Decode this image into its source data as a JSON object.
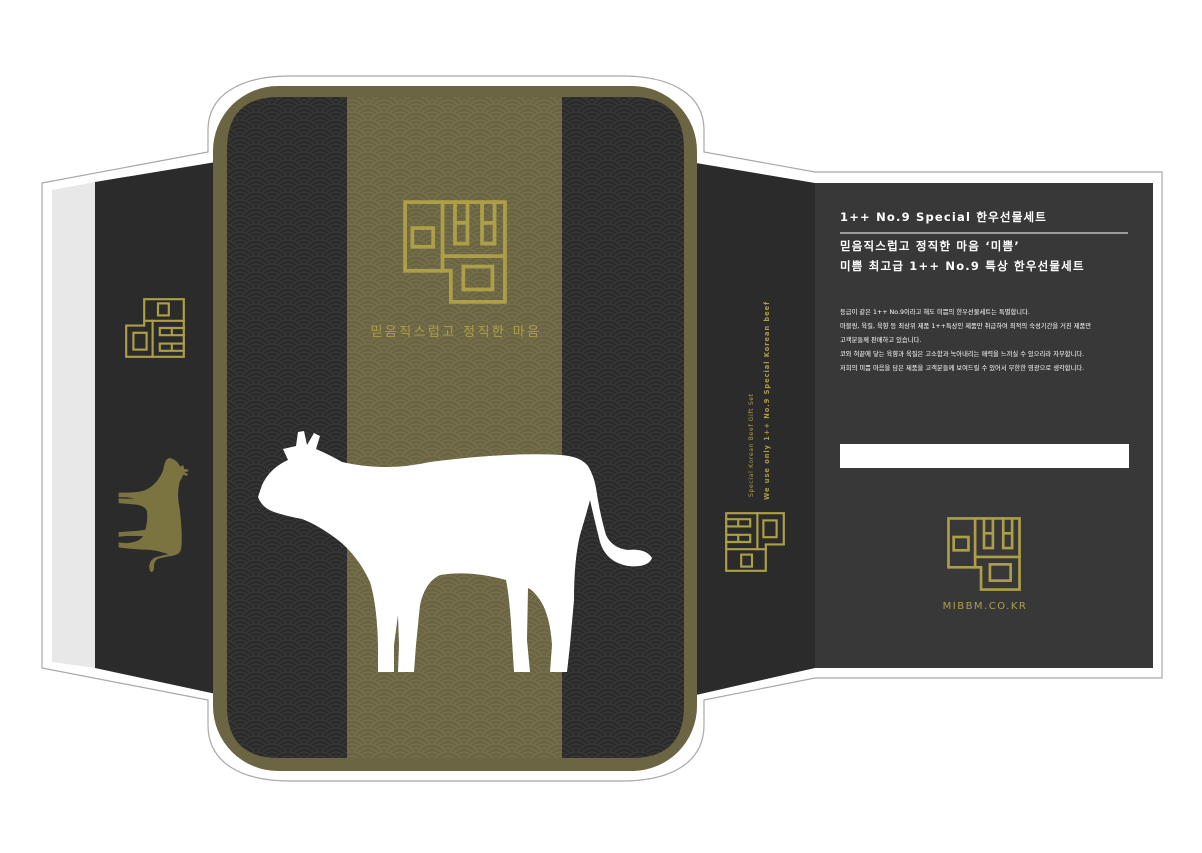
{
  "brand": {
    "name": "미쁨",
    "logo_icon": "mibbm-logo-icon"
  },
  "front_panel": {
    "slogan": "믿음직스럽고 정직한 마음",
    "illustration": "cow-silhouette-icon"
  },
  "side_flap": {
    "caption_1": "Special Korean Beef Gift Set",
    "caption_2": "We use only 1++ No.9 Special Korean beef"
  },
  "back_panel": {
    "heading": "1++ No.9 Special 한우선물세트",
    "title_line_1": "믿음직스럽고 정직한 마음 ‘미쁨’",
    "title_line_2": "미쁨 최고급 1++ No.9 특상 한우선물세트",
    "body": [
      "등급이 같은 1++ No.9이라고 해도 미쁨의 한우선물세트는 특별합니다.",
      "마블링, 육질, 육향 등 최상위 제품 1++특상인 제품만 취급하여 최적의 숙성기간을 거친 제품만",
      "고객분들께 판매하고 있습니다.",
      "코와 혀끝에 닿는 육향과 육질은 고소함과 녹아내리는 매력을 느끼실 수 있으리라 자부합니다.",
      "저희의 미쁨 마음을 담은 제품을 고객분들께 보여드릴 수 있어서 무한한 영광으로 생각합니다."
    ],
    "website": "MIBBM.CO.KR"
  },
  "colors": {
    "dieline_fill": "#ffffff",
    "dieline_stroke": "#a8a8a8",
    "glue_flap": "#e8e8e8",
    "dark_panel": "#2b2b2b",
    "back_panel": "#383838",
    "olive": "#6b6543",
    "gold": "#ad9f47",
    "text_light": "#ffffff",
    "label_white": "#ffffff",
    "cow_front": "#ffffff",
    "cow_side": "#7b7440"
  }
}
